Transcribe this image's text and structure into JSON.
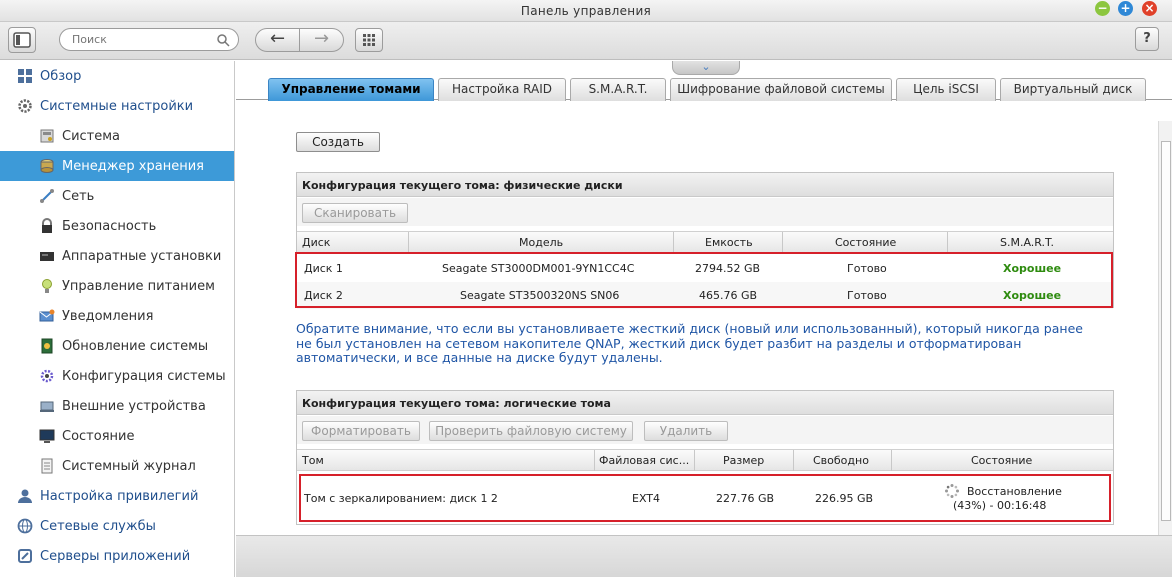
{
  "window": {
    "title": "Панель управления"
  },
  "toolbar": {
    "search_placeholder": "Поиск",
    "help_label": "?"
  },
  "sidebar": {
    "items": [
      {
        "label": "Обзор",
        "level": "top",
        "icon": "grid-icon"
      },
      {
        "label": "Системные настройки",
        "level": "top",
        "icon": "gear-icon"
      },
      {
        "label": "Система",
        "level": "sub",
        "icon": "system-icon"
      },
      {
        "label": "Менеджер хранения",
        "level": "sub",
        "icon": "storage-icon",
        "active": true
      },
      {
        "label": "Сеть",
        "level": "sub",
        "icon": "network-icon"
      },
      {
        "label": "Безопасность",
        "level": "sub",
        "icon": "lock-icon"
      },
      {
        "label": "Аппаратные установки",
        "level": "sub",
        "icon": "hardware-icon"
      },
      {
        "label": "Управление питанием",
        "level": "sub",
        "icon": "bulb-icon"
      },
      {
        "label": "Уведомления",
        "level": "sub",
        "icon": "notification-icon"
      },
      {
        "label": "Обновление системы",
        "level": "sub",
        "icon": "update-icon"
      },
      {
        "label": "Конфигурация системы",
        "level": "sub",
        "icon": "config-icon"
      },
      {
        "label": "Внешние устройства",
        "level": "sub",
        "icon": "external-device-icon"
      },
      {
        "label": "Состояние",
        "level": "sub",
        "icon": "monitor-icon"
      },
      {
        "label": "Системный журнал",
        "level": "sub",
        "icon": "log-icon"
      },
      {
        "label": "Настройка привилегий",
        "level": "top",
        "icon": "user-icon"
      },
      {
        "label": "Сетевые службы",
        "level": "top",
        "icon": "globe-icon"
      },
      {
        "label": "Серверы приложений",
        "level": "top",
        "icon": "app-server-icon"
      }
    ]
  },
  "tabs": [
    {
      "label": "Управление томами",
      "active": true
    },
    {
      "label": "Настройка RAID"
    },
    {
      "label": "S.M.A.R.T."
    },
    {
      "label": "Шифрование файловой системы"
    },
    {
      "label": "Цель iSCSI"
    },
    {
      "label": "Виртуальный диск"
    }
  ],
  "main": {
    "create_label": "Создать",
    "physical": {
      "title": "Конфигурация текущего тома: физические диски",
      "scan_label": "Сканировать",
      "columns": [
        "Диск",
        "Модель",
        "Емкость",
        "Состояние",
        "S.M.A.R.T."
      ],
      "rows": [
        {
          "disk": "Диск 1",
          "model": "Seagate ST3000DM001-9YN1CC4C",
          "capacity": "2794.52 GB",
          "state": "Готово",
          "smart": "Хорошее"
        },
        {
          "disk": "Диск 2",
          "model": "Seagate ST3500320NS SN06",
          "capacity": "465.76 GB",
          "state": "Готово",
          "smart": "Хорошее"
        }
      ]
    },
    "notice": "Обратите внимание, что если вы установливаете жесткий диск (новый или использованный), который никогда ранее не был установлен на сетевом накопителе QNAP, жесткий диск будет разбит на разделы и отформатирован автоматически, и все данные на диске будут удалены.",
    "logical": {
      "title": "Конфигурация текущего тома: логические тома",
      "format_label": "Форматировать",
      "check_label": "Проверить файловую систему",
      "delete_label": "Удалить",
      "columns": [
        "Том",
        "Файловая сис...",
        "Размер",
        "Свободно",
        "Состояние"
      ],
      "rows": [
        {
          "volume": "Том с зеркалированием: диск 1 2",
          "fs": "EXT4",
          "size": "227.76 GB",
          "free": "226.95 GB",
          "state_line1": "Восстановление",
          "state_line2": "(43%) - 00:16:48",
          "progress": 43
        }
      ]
    }
  },
  "colors": {
    "accent": "#3d9ad8",
    "good": "#2e8b0f",
    "highlight": "#d6202a",
    "notice": "#1f55a5"
  }
}
